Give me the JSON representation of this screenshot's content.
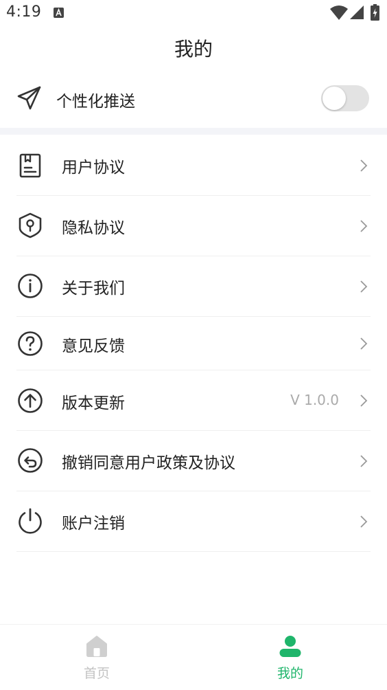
{
  "status_bar": {
    "time": "4:19"
  },
  "header": {
    "title": "我的"
  },
  "push": {
    "label": "个性化推送",
    "enabled": false
  },
  "menu": {
    "items": [
      {
        "label": "用户协议",
        "icon": "document-icon"
      },
      {
        "label": "隐私协议",
        "icon": "shield-location-icon"
      },
      {
        "label": "关于我们",
        "icon": "info-icon"
      },
      {
        "label": "意见反馈",
        "icon": "question-icon"
      },
      {
        "label": "版本更新",
        "icon": "upload-arrow-icon",
        "value": "V 1.0.0"
      },
      {
        "label": "撤销同意用户政策及协议",
        "icon": "revoke-icon"
      },
      {
        "label": "账户注销",
        "icon": "power-icon"
      }
    ]
  },
  "bottom_nav": {
    "items": [
      {
        "label": "首页",
        "icon": "home-icon",
        "active": false
      },
      {
        "label": "我的",
        "icon": "person-icon",
        "active": true
      }
    ]
  },
  "colors": {
    "accent": "#1fb56b",
    "inactive": "#c3c3c3",
    "divider": "#f3f4f8"
  }
}
